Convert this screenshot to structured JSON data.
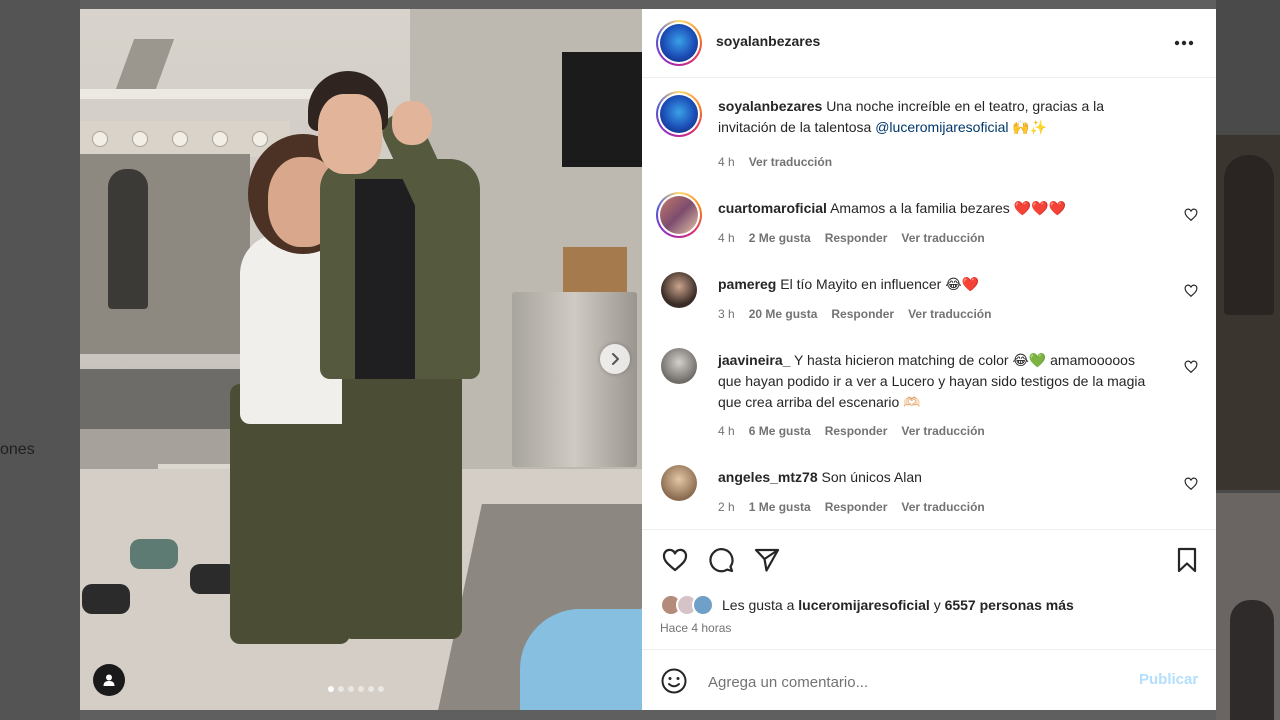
{
  "background": {
    "left_partial_text": "ones"
  },
  "post": {
    "author": "soyalanbezares",
    "caption_text": "Una noche increíble en el teatro, gracias a la invitación de la talentosa",
    "caption_mention": "@luceromijaresoficial",
    "caption_emojis": "🙌✨",
    "caption_time": "4 h",
    "caption_translate": "Ver traducción",
    "carousel_slides": 6,
    "carousel_active_index": 0
  },
  "comments": [
    {
      "username": "cuartomaroficial",
      "text": "Amamos a la familia bezares",
      "emojis": "❤️❤️❤️",
      "time": "4 h",
      "likes": "2 Me gusta",
      "reply": "Responder",
      "translate": "Ver traducción"
    },
    {
      "username": "pamereg",
      "text": "El tío Mayito en influencer",
      "emojis": "😂❤️",
      "time": "3 h",
      "likes": "20 Me gusta",
      "reply": "Responder",
      "translate": "Ver traducción"
    },
    {
      "username": "jaavineira_",
      "text": "Y hasta hicieron matching de color 😂💚 amamooooos que hayan podido ir a ver a Lucero y hayan sido testigos de la magia que crea arriba del escenario 🫶🏻",
      "emojis": "",
      "time": "4 h",
      "likes": "6 Me gusta",
      "reply": "Responder",
      "translate": "Ver traducción"
    },
    {
      "username": "angeles_mtz78",
      "text": "Son únicos Alan",
      "emojis": "",
      "time": "2 h",
      "likes": "1 Me gusta",
      "reply": "Responder",
      "translate": "Ver traducción"
    }
  ],
  "likes": {
    "prefix": "Les gusta a",
    "user": "luceromijaresoficial",
    "connector": "y",
    "others": "6557 personas más",
    "time_ago": "Hace 4 horas"
  },
  "add_comment": {
    "placeholder": "Agrega un comentario...",
    "publish_label": "Publicar"
  },
  "icons": {
    "like": "heart-icon",
    "comment": "comment-bubble-icon",
    "share": "paper-plane-icon",
    "save": "bookmark-icon",
    "more": "more-options-icon",
    "emoji": "emoji-icon",
    "next": "chevron-right-icon",
    "tag": "user-tag-icon"
  },
  "colors": {
    "mention": "#00376b",
    "muted": "#737373",
    "publish_disabled": "#b2dffc",
    "heart_red": "#ed4956"
  }
}
